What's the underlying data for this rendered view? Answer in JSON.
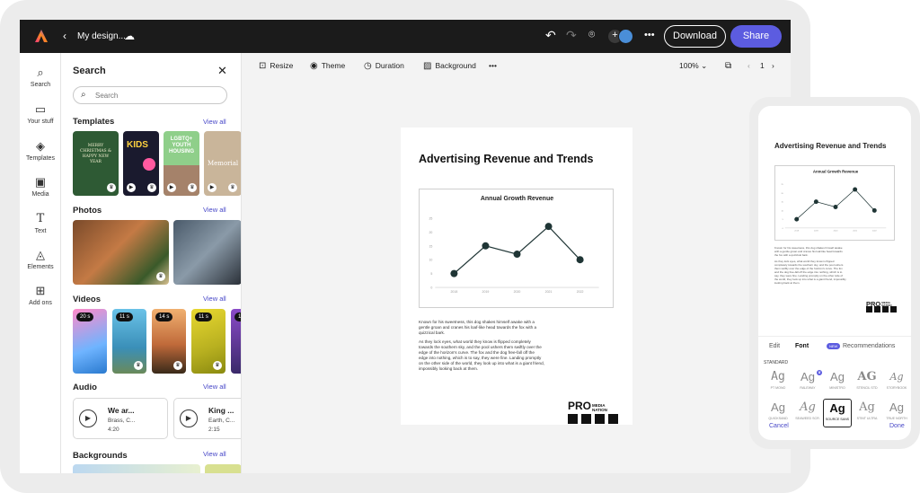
{
  "topbar": {
    "doc_name": "My design...",
    "download_label": "Download",
    "share_label": "Share"
  },
  "toolbar": {
    "resize": "Resize",
    "theme": "Theme",
    "duration": "Duration",
    "background": "Background",
    "more": "•••",
    "zoom": "100%",
    "page": "1"
  },
  "leftnav": [
    {
      "label": "Search",
      "icon": "search-icon"
    },
    {
      "label": "Your stuff",
      "icon": "folder-icon"
    },
    {
      "label": "Templates",
      "icon": "templates-icon"
    },
    {
      "label": "Media",
      "icon": "media-icon"
    },
    {
      "label": "Text",
      "icon": "text-icon"
    },
    {
      "label": "Elements",
      "icon": "elements-icon"
    },
    {
      "label": "Add ons",
      "icon": "addons-icon"
    }
  ],
  "panel": {
    "title": "Search",
    "search_placeholder": "Search",
    "view_all": "View all",
    "templates_title": "Templates",
    "templates": [
      {
        "text": "MERRY CHRISTMAS & HAPPY NEW YEAR"
      },
      {
        "text": "KIDS"
      },
      {
        "text": "LGBTQ+ YOUTH HOUSING"
      },
      {
        "text": "Memorial"
      }
    ],
    "photos_title": "Photos",
    "videos_title": "Videos",
    "videos": [
      {
        "duration": "20 s"
      },
      {
        "duration": "11 s"
      },
      {
        "duration": "14 s"
      },
      {
        "duration": "11 s"
      },
      {
        "duration": "17"
      }
    ],
    "audio_title": "Audio",
    "audio": [
      {
        "title": "We ar...",
        "artist": "Brass, C...",
        "duration": "4:20"
      },
      {
        "title": "King ...",
        "artist": "Earth, C...",
        "duration": "2:15"
      }
    ],
    "backgrounds_title": "Backgrounds"
  },
  "document": {
    "title": "Advertising Revenue and Trends",
    "paragraphs": [
      "Known for his sweetness, this dog shakes himself awake with a gentle groan and cranes his loaf-like head towards the fox with a quizzical bark.",
      "As they lock eyes, what world they know is flipped completely towards the southern sky, and the pool ushers them swiftly over the edge of the horizon's curve. The fox and the dog free-fall off the edge into nothing, which is to say, they were fine. Landing promptly on the other side of the world, they look up into what is a giant friend, impossibly looking back at them."
    ],
    "brand_main": "PRO",
    "brand_sub1": "MEDIA",
    "brand_sub2": "NATION"
  },
  "chart_data": {
    "type": "line",
    "title": "Annual Growth Revenue",
    "categories": [
      "2018",
      "2019",
      "2020",
      "2021",
      "2022"
    ],
    "values": [
      5,
      15,
      12,
      22,
      10
    ],
    "yticks": [
      "0",
      "5",
      "10",
      "15",
      "20",
      "25"
    ],
    "ylim": [
      0,
      25
    ],
    "xlabel": "",
    "ylabel": "",
    "grid": false,
    "color": "#1f3535"
  },
  "phone": {
    "tabs": {
      "edit": "Edit",
      "font": "Font",
      "new_badge": "NEW",
      "recommendations": "Recommendations"
    },
    "standard_label": "STANDARD",
    "fonts": [
      {
        "name": "PT MONO"
      },
      {
        "name": "RALEWAY"
      },
      {
        "name": "MINISTRO"
      },
      {
        "name": "STENCIL STD"
      },
      {
        "name": "STORYBOOK"
      },
      {
        "name": "QUICKSAND"
      },
      {
        "name": "SEAWEED SCR."
      },
      {
        "name": "SOURCE SANS"
      },
      {
        "name": "STINT ULTRA"
      },
      {
        "name": "TRUE NORTH"
      }
    ],
    "cancel": "Cancel",
    "done": "Done"
  }
}
